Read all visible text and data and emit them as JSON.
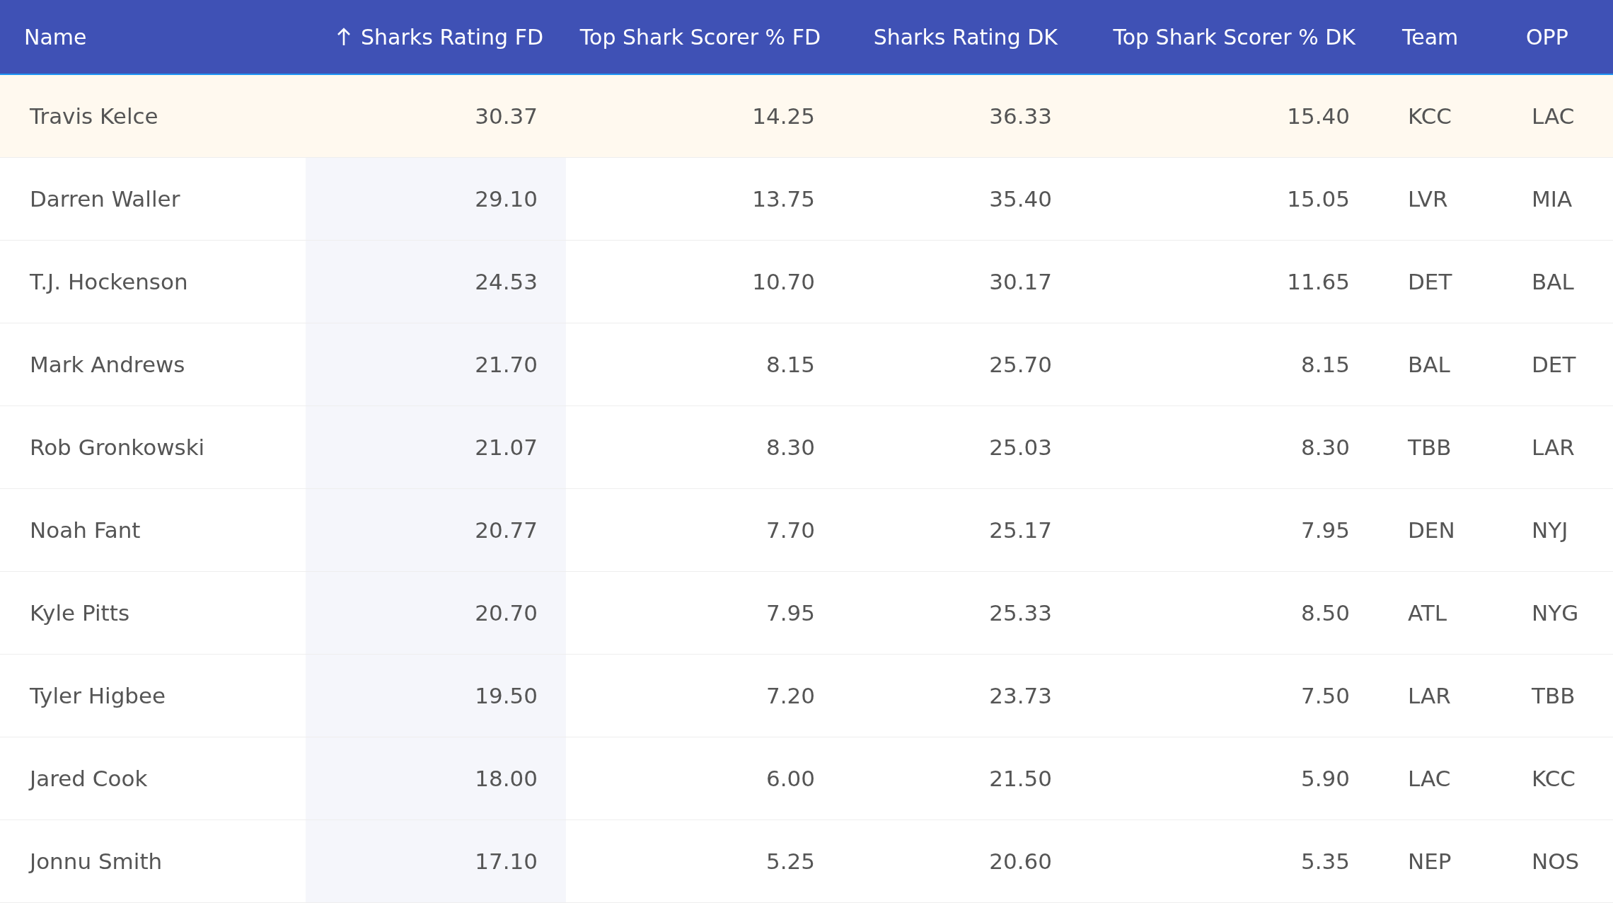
{
  "table": {
    "columns": [
      {
        "label": "Name",
        "kind": "text",
        "sorted": false
      },
      {
        "label": "Sharks Rating FD",
        "kind": "number",
        "sorted": true
      },
      {
        "label": "Top Shark Scorer % FD",
        "kind": "number",
        "sorted": false
      },
      {
        "label": "Sharks Rating DK",
        "kind": "number",
        "sorted": false
      },
      {
        "label": "Top Shark Scorer % DK",
        "kind": "number",
        "sorted": false
      },
      {
        "label": "Team",
        "kind": "text",
        "sorted": false
      },
      {
        "label": "OPP",
        "kind": "text",
        "sorted": false
      }
    ],
    "rows": [
      {
        "selected": true,
        "cells": [
          "Travis Kelce",
          "30.37",
          "14.25",
          "36.33",
          "15.40",
          "KCC",
          "LAC"
        ]
      },
      {
        "selected": false,
        "cells": [
          "Darren Waller",
          "29.10",
          "13.75",
          "35.40",
          "15.05",
          "LVR",
          "MIA"
        ]
      },
      {
        "selected": false,
        "cells": [
          "T.J. Hockenson",
          "24.53",
          "10.70",
          "30.17",
          "11.65",
          "DET",
          "BAL"
        ]
      },
      {
        "selected": false,
        "cells": [
          "Mark Andrews",
          "21.70",
          "8.15",
          "25.70",
          "8.15",
          "BAL",
          "DET"
        ]
      },
      {
        "selected": false,
        "cells": [
          "Rob Gronkowski",
          "21.07",
          "8.30",
          "25.03",
          "8.30",
          "TBB",
          "LAR"
        ]
      },
      {
        "selected": false,
        "cells": [
          "Noah Fant",
          "20.77",
          "7.70",
          "25.17",
          "7.95",
          "DEN",
          "NYJ"
        ]
      },
      {
        "selected": false,
        "cells": [
          "Kyle Pitts",
          "20.70",
          "7.95",
          "25.33",
          "8.50",
          "ATL",
          "NYG"
        ]
      },
      {
        "selected": false,
        "cells": [
          "Tyler Higbee",
          "19.50",
          "7.20",
          "23.73",
          "7.50",
          "LAR",
          "TBB"
        ]
      },
      {
        "selected": false,
        "cells": [
          "Jared Cook",
          "18.00",
          "6.00",
          "21.50",
          "5.90",
          "LAC",
          "KCC"
        ]
      },
      {
        "selected": false,
        "cells": [
          "Jonnu Smith",
          "17.10",
          "5.25",
          "20.60",
          "5.35",
          "NEP",
          "NOS"
        ]
      }
    ]
  }
}
